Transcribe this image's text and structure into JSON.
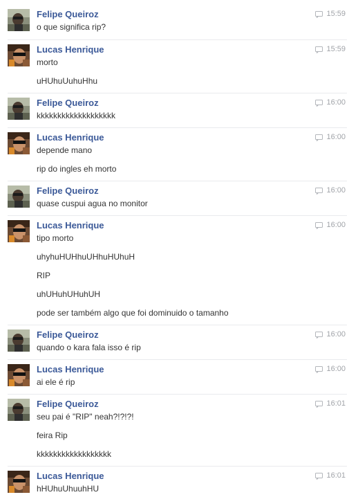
{
  "conversation": [
    {
      "sender": "Felipe Queiroz",
      "time": "15:59",
      "lines": [
        "o que significa rip?"
      ]
    },
    {
      "sender": "Lucas Henrique",
      "time": "15:59",
      "lines": [
        "morto",
        "uHUhuUuhuHhu"
      ]
    },
    {
      "sender": "Felipe Queiroz",
      "time": "16:00",
      "lines": [
        "kkkkkkkkkkkkkkkkkkk"
      ]
    },
    {
      "sender": "Lucas Henrique",
      "time": "16:00",
      "lines": [
        "depende mano",
        "rip do ingles eh morto"
      ]
    },
    {
      "sender": "Felipe Queiroz",
      "time": "16:00",
      "lines": [
        "quase cuspui agua no monitor"
      ]
    },
    {
      "sender": "Lucas Henrique",
      "time": "16:00",
      "lines": [
        "tipo morto",
        "uhyhuHUHhuUHhuHUhuH",
        "RIP",
        "uhUHuhUHuhUH",
        "pode ser também algo que foi dominuido o tamanho"
      ]
    },
    {
      "sender": "Felipe Queiroz",
      "time": "16:00",
      "lines": [
        "quando o kara fala isso é rip"
      ]
    },
    {
      "sender": "Lucas Henrique",
      "time": "16:00",
      "lines": [
        "ai ele é rip"
      ]
    },
    {
      "sender": "Felipe Queiroz",
      "time": "16:01",
      "lines": [
        "seu pai é \"RIP\" neah?!?!?!",
        "feira Rip",
        "kkkkkkkkkkkkkkkkkk"
      ]
    },
    {
      "sender": "Lucas Henrique",
      "time": "16:01",
      "lines": [
        "hHUhuUhuuhHU"
      ]
    }
  ],
  "icons": {
    "timestamp": "chat-bubble-icon",
    "avatar": "profile-photo"
  },
  "colors": {
    "sender_name": "#3b5998",
    "message_text": "#333333",
    "timestamp": "#a0a3a8",
    "divider": "#e9eaed"
  }
}
